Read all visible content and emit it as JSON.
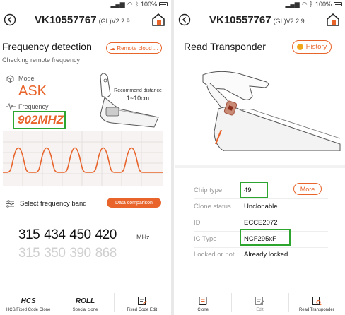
{
  "status_bar": {
    "battery": "100%"
  },
  "left": {
    "device_name": "VK10557767",
    "device_version": "(GL)V2.2.9",
    "title": "Frequency detection",
    "remote_button": "Remote cloud ...",
    "subtitle": "Checking remote frequency",
    "mode_label": "Mode",
    "mode_value": "ASK",
    "frequency_label": "Frequency",
    "frequency_value": "902MHZ",
    "recommend_label": "Recommend distance",
    "recommend_value": "1~10cm",
    "select_band_label": "Select frequency band",
    "compare_button": "Data comparison",
    "freq_numbers": [
      "315",
      "434",
      "450",
      "420"
    ],
    "freq_unit": "MHz",
    "freq_numbers_faded": [
      "315",
      "350",
      "390",
      "868"
    ],
    "nav": [
      {
        "label": "HCS/Fixed Code Clone",
        "icon": "hcs-icon",
        "glyph": "HCS"
      },
      {
        "label": "Special clone",
        "icon": "roll-icon",
        "glyph": "ROLL"
      },
      {
        "label": "Fixed Code Edit",
        "icon": "edit-icon"
      }
    ]
  },
  "right": {
    "device_name": "VK10557767",
    "device_version": "(GL)V2.2.9",
    "title": "Read Transponder",
    "history_button": "History",
    "more_button": "More",
    "rows": [
      {
        "label": "Chip type",
        "value": "49"
      },
      {
        "label": "Clone status",
        "value": "Unclonable"
      },
      {
        "label": "ID",
        "value": "ECCE2072"
      },
      {
        "label": "IC Type",
        "value": "NCF295xF"
      },
      {
        "label": "Locked or not",
        "value": "Already locked"
      }
    ],
    "nav": [
      {
        "label": "Clone",
        "icon": "clone-icon"
      },
      {
        "label": "Edit",
        "icon": "edit-icon"
      },
      {
        "label": "Read Transponder",
        "icon": "read-transponder-icon"
      }
    ]
  },
  "colors": {
    "accent": "#e8642a",
    "highlight": "#2ea52e"
  }
}
